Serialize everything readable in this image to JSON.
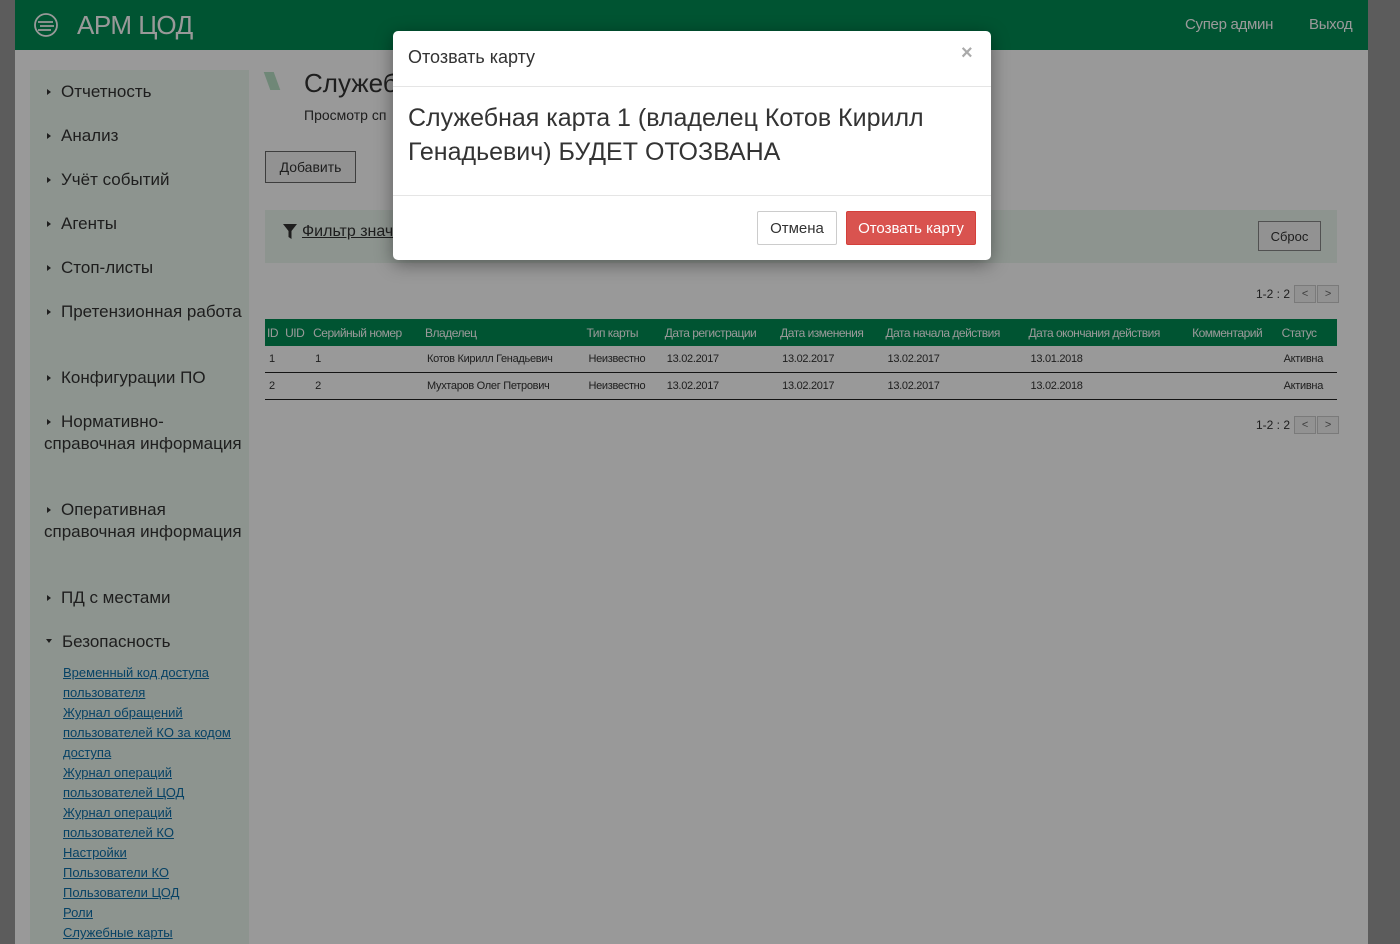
{
  "header": {
    "app_title": "АРМ ЦОД",
    "user_link": "Супер админ",
    "logout_link": "Выход"
  },
  "sidebar": {
    "items": [
      {
        "label": "Отчетность"
      },
      {
        "label": "Анализ"
      },
      {
        "label": "Учёт событий"
      },
      {
        "label": "Агенты"
      },
      {
        "label": "Стоп-листы"
      },
      {
        "label": "Претензионная работа"
      },
      {
        "label": "Конфигурации ПО"
      },
      {
        "label": "Нормативно-справочная информация"
      },
      {
        "label": "Оперативная справочная информация"
      },
      {
        "label": "ПД с местами"
      },
      {
        "label": "Безопасность"
      }
    ],
    "security_links": [
      "Временный код доступа пользователя",
      "Журнал обращений пользователей КО за кодом доступа",
      "Журнал операций пользователей ЦОД",
      "Журнал операций пользователей КО",
      "Настройки",
      "Пользователи КО",
      "Пользователи ЦОД",
      "Роли",
      "Служебные карты"
    ]
  },
  "content": {
    "title": "Служебные карты",
    "title_visible": "Служеб",
    "subtitle_visible": "Просмотр сп",
    "add_button": "Добавить",
    "filter_label": "Фильтр знач",
    "reset_button": "Сброс",
    "pager_text": "1-2 : 2",
    "pager_prev": "<",
    "pager_next": ">"
  },
  "table": {
    "columns": [
      "ID",
      "UID",
      "Серийный номер",
      "Владелец",
      "Тип карты",
      "Дата регистрации",
      "Дата изменения",
      "Дата начала действия",
      "Дата окончания действия",
      "Комментарий",
      "Статус"
    ],
    "rows": [
      [
        "1",
        "",
        "1",
        "Котов Кирилл Генадьевич",
        "Неизвестно",
        "13.02.2017",
        "13.02.2017",
        "13.02.2017",
        "13.01.2018",
        "",
        "Активна"
      ],
      [
        "2",
        "",
        "2",
        "Мухтаров Олег Петрович",
        "Неизвестно",
        "13.02.2017",
        "13.02.2017",
        "13.02.2017",
        "13.02.2018",
        "",
        "Активна"
      ]
    ]
  },
  "modal": {
    "title": "Отозвать карту",
    "close": "×",
    "message": "Служебная карта 1 (владелец Котов Кирилл Генадьевич) БУДЕТ ОТОЗВАНА",
    "cancel_button": "Отмена",
    "confirm_button": "Отозвать карту"
  },
  "colors": {
    "brand_green": "#008d54",
    "sidebar_bg": "#ecf7ee",
    "danger": "#d9534f",
    "link": "#0d6ea8"
  }
}
